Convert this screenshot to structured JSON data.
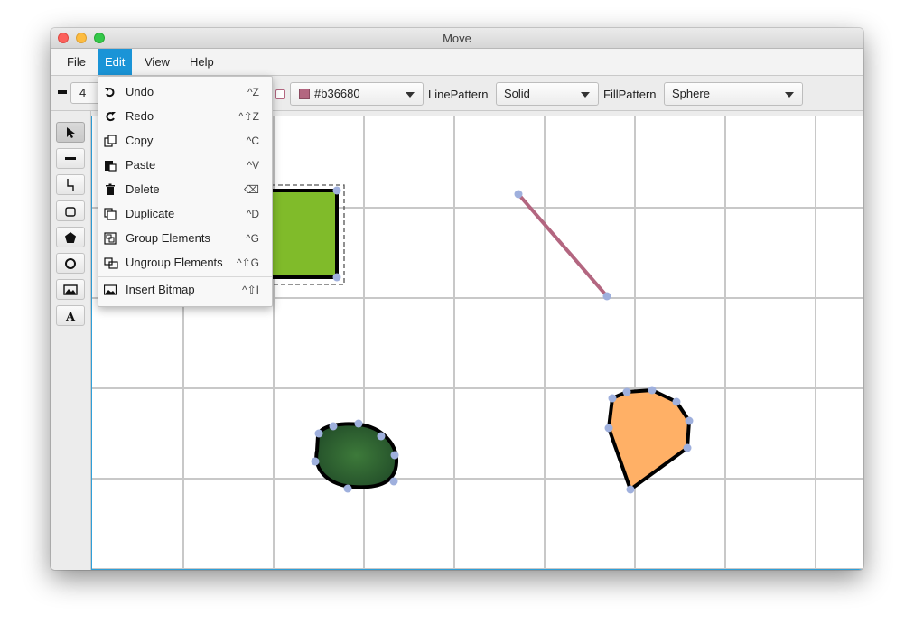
{
  "window": {
    "title": "Move"
  },
  "menubar": [
    {
      "label": "File"
    },
    {
      "label": "Edit"
    },
    {
      "label": "View"
    },
    {
      "label": "Help"
    }
  ],
  "toolbar": {
    "line_width": "4",
    "line_color": "#b36680",
    "line_pattern_label": "LinePattern",
    "line_pattern_value": "Solid",
    "fill_pattern_label": "FillPattern",
    "fill_pattern_value": "Sphere"
  },
  "edit_menu": [
    {
      "label": "Undo",
      "shortcut": "^Z",
      "icon": "undo-icon"
    },
    {
      "label": "Redo",
      "shortcut": "^⇧Z",
      "icon": "redo-icon"
    },
    {
      "label": "Copy",
      "shortcut": "^C",
      "icon": "copy-icon"
    },
    {
      "label": "Paste",
      "shortcut": "^V",
      "icon": "paste-icon"
    },
    {
      "label": "Delete",
      "shortcut": "⌫",
      "icon": "trash-icon"
    },
    {
      "label": "Duplicate",
      "shortcut": "^D",
      "icon": "duplicate-icon"
    },
    {
      "label": "Group Elements",
      "shortcut": "^G",
      "icon": "group-icon"
    },
    {
      "label": "Ungroup Elements",
      "shortcut": "^⇧G",
      "icon": "ungroup-icon"
    },
    {
      "label": "Insert Bitmap",
      "shortcut": "^⇧I",
      "icon": "image-icon"
    }
  ],
  "tools": [
    "select-tool",
    "line-tool",
    "polyline-tool",
    "rectangle-tool",
    "polygon-tool",
    "ellipse-tool",
    "bitmap-tool",
    "text-tool"
  ],
  "colors": {
    "rect_fill": "#80bb2a",
    "line_stroke": "#b36680",
    "blob_fill": "#2f5f2e",
    "poly_fill": "#ffb066",
    "handle": "#9fb0dd",
    "accent": "#1a94d7"
  }
}
